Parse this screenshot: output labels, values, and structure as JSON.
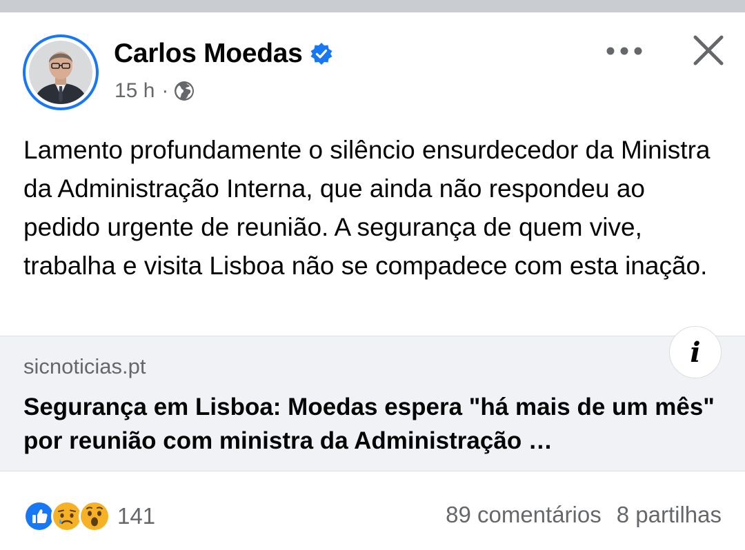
{
  "post": {
    "author": "Carlos Moedas",
    "time": "15 h",
    "separator": "·",
    "text": "Lamento profundamente o silêncio ensurdecedor da Ministra da Administração Interna, que ainda não respondeu ao pedido urgente de reunião. A segurança de quem vive, trabalha e visita Lisboa não se compadece com esta inação."
  },
  "link": {
    "domain": "sicnoticias.pt",
    "title": "Segurança em Lisboa: Moedas espera \"há mais de um mês\" por reunião com ministra da Administração …",
    "info_label": "i"
  },
  "footer": {
    "reaction_count": "141",
    "comments": "89 comentários",
    "shares": "8 partilhas"
  },
  "icons": {
    "verified": "verified-badge-icon",
    "audience": "globe-icon",
    "more": "more-options-icon",
    "close": "close-icon",
    "reactions": [
      "like-reaction-icon",
      "sad-reaction-icon",
      "wow-reaction-icon"
    ]
  },
  "colors": {
    "accent": "#1877f2",
    "secondary_text": "#65676b",
    "card_background": "#f0f2f5"
  }
}
